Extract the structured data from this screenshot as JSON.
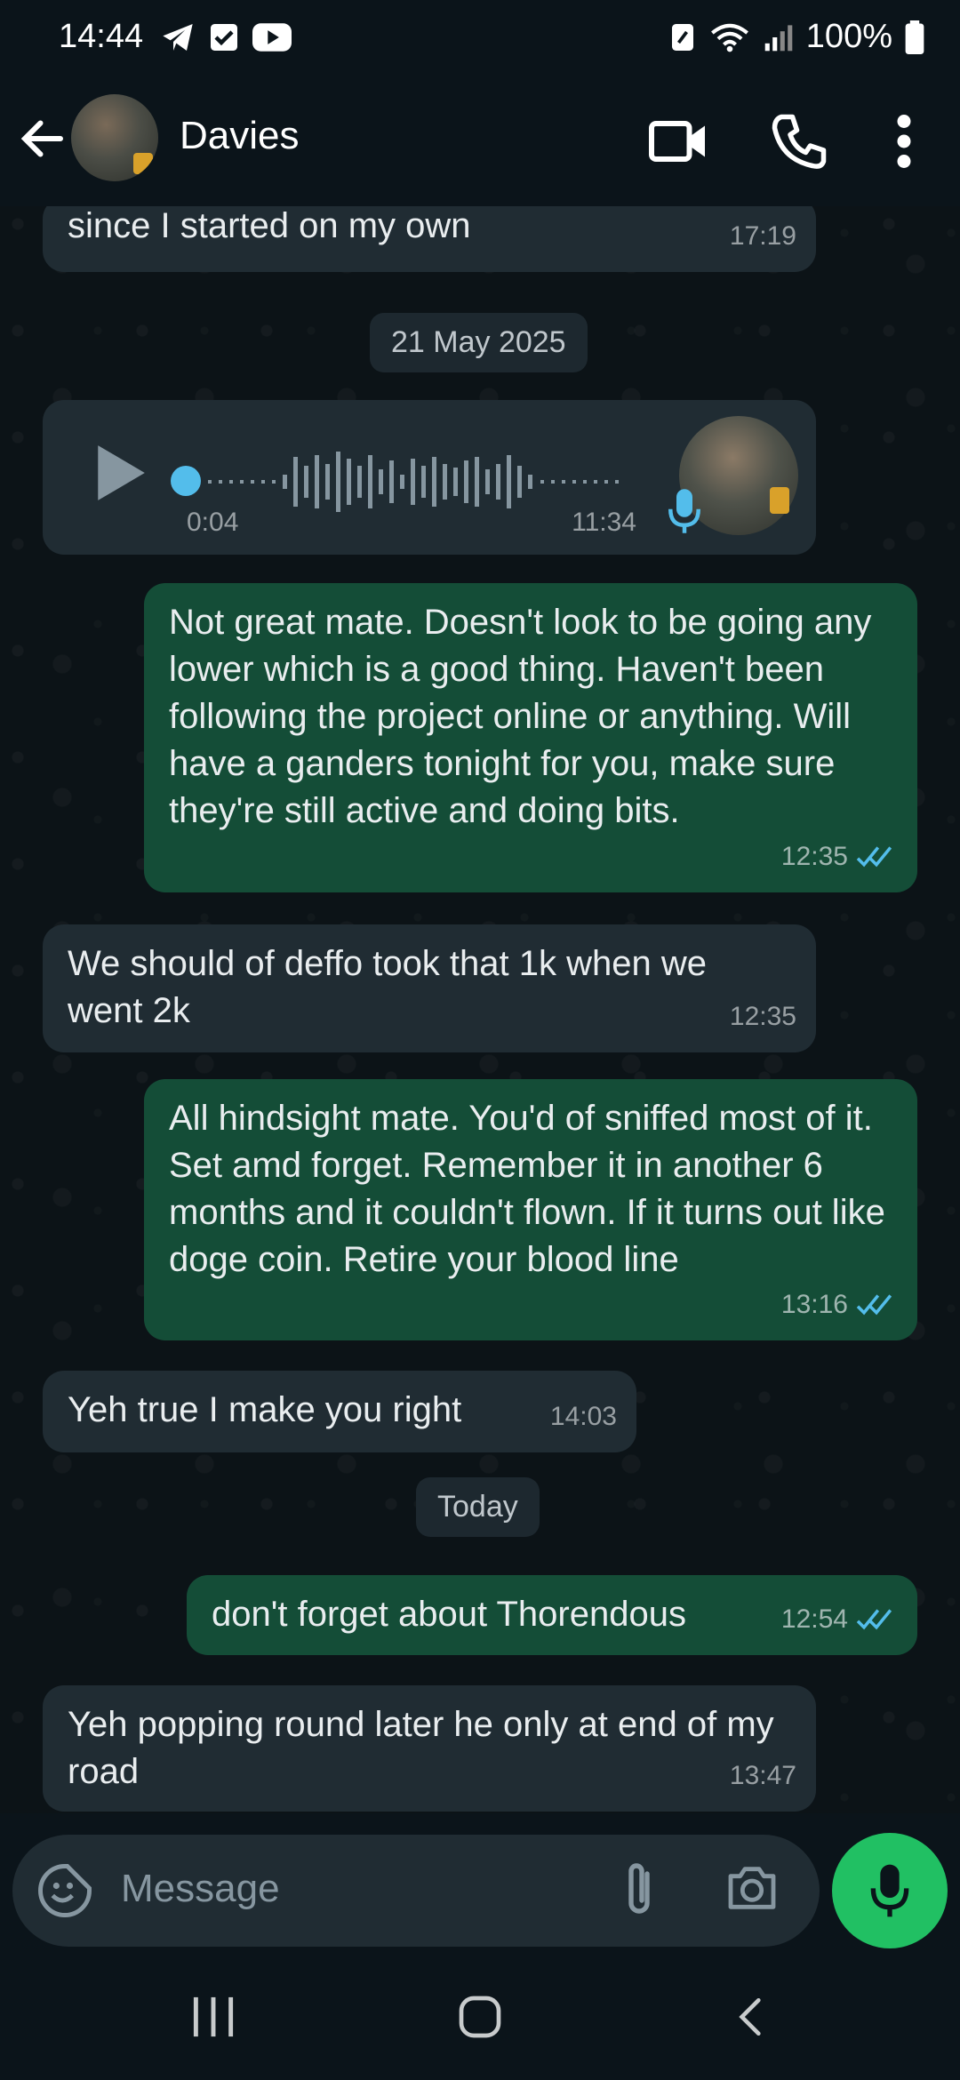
{
  "status_bar": {
    "time": "14:44",
    "battery": "100%",
    "left_icons": [
      "telegram-icon",
      "checkbox-icon",
      "youtube-icon"
    ],
    "right_icons": [
      "nfc-icon",
      "wifi-icon",
      "signal-icon",
      "battery-icon"
    ]
  },
  "header": {
    "contact_name": "Davies",
    "icons": [
      "back-arrow-icon",
      "video-call-icon",
      "phone-icon",
      "more-vertical-icon"
    ]
  },
  "messages": [
    {
      "direction": "in",
      "text": "since I started on my own",
      "time": "17:19"
    },
    {
      "type": "date",
      "text": "21 May 2025"
    },
    {
      "direction": "in",
      "type": "voice",
      "duration": "0:04",
      "time": "11:34"
    },
    {
      "direction": "out",
      "text": "Not great mate. Doesn't look to be going any lower which is a good thing. Haven't been following the project online or anything. Will have a ganders tonight for you, make sure they're still active and doing bits.",
      "time": "12:35",
      "read": true
    },
    {
      "direction": "in",
      "text": "We should of deffo took that 1k when we went 2k",
      "time": "12:35"
    },
    {
      "direction": "out",
      "text": "All hindsight mate. You'd of sniffed most of it. Set amd forget. Remember it in another 6 months and it couldn't flown. If it turns out like doge coin. Retire your blood line",
      "time": "13:16",
      "read": true
    },
    {
      "direction": "in",
      "text": "Yeh true I make you right",
      "time": "14:03"
    },
    {
      "type": "date",
      "text": "Today"
    },
    {
      "direction": "out",
      "text": "don't forget about Thorendous",
      "time": "12:54",
      "read": true
    },
    {
      "direction": "in",
      "text": "Yeh popping round later he only at end of my road",
      "time": "13:47"
    }
  ],
  "composer": {
    "placeholder": "Message",
    "icons": [
      "emoji-sticker-icon",
      "paperclip-icon",
      "camera-icon",
      "mic-icon"
    ]
  },
  "nav_bar": {
    "icons": [
      "recent-apps-icon",
      "home-icon",
      "back-icon"
    ]
  },
  "colors": {
    "incoming_bubble": "#202c33",
    "outgoing_bubble": "#144d37",
    "read_ticks": "#53bdeb",
    "mic_button": "#21c063"
  }
}
